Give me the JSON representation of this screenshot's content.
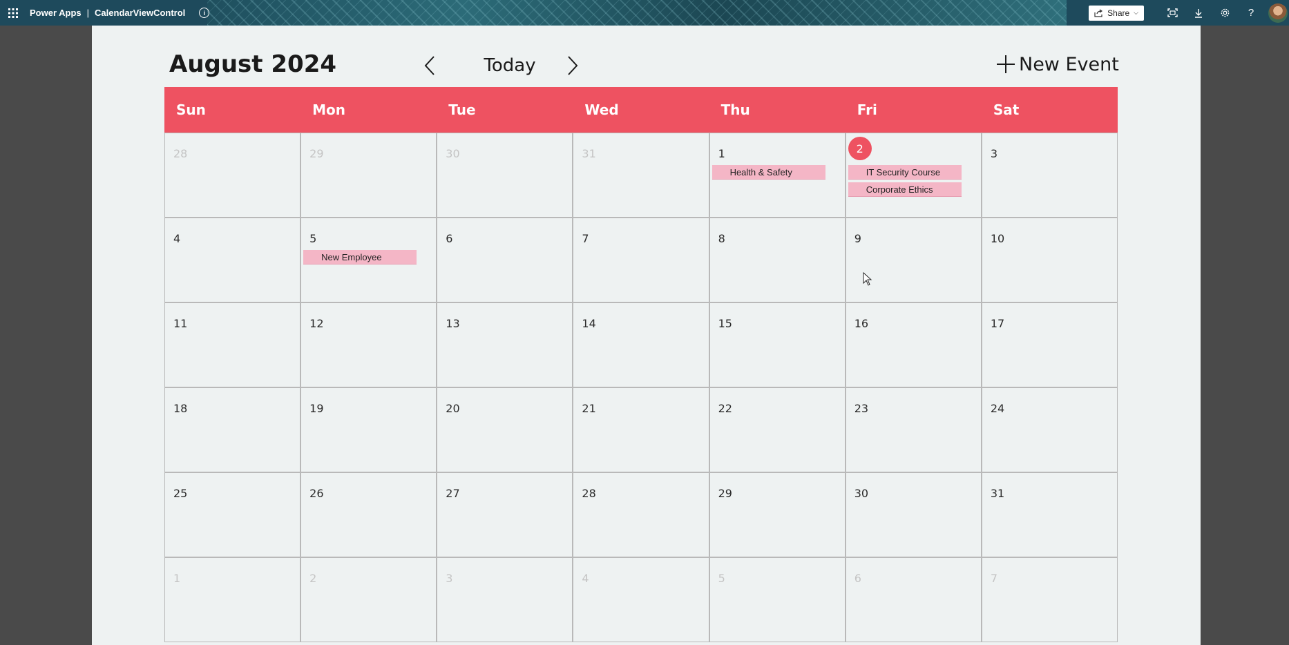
{
  "topbar": {
    "app_name": "Power Apps",
    "separator": "|",
    "app_title": "CalendarViewControl",
    "share_label": "Share",
    "icons": [
      "waffle-icon",
      "info-icon",
      "share-icon",
      "fit-screen-icon",
      "download-icon",
      "settings-icon",
      "help-icon",
      "avatar"
    ]
  },
  "calendar": {
    "title": "August 2024",
    "today_label": "Today",
    "new_event_label": "New Event",
    "day_headers": [
      "Sun",
      "Mon",
      "Tue",
      "Wed",
      "Thu",
      "Fri",
      "Sat"
    ],
    "weeks": [
      [
        {
          "day": "28",
          "other": true
        },
        {
          "day": "29",
          "other": true
        },
        {
          "day": "30",
          "other": true
        },
        {
          "day": "31",
          "other": true
        },
        {
          "day": "1",
          "events": [
            "Health & Safety"
          ]
        },
        {
          "day": "2",
          "today": true,
          "events": [
            "IT Security Course",
            "Corporate Ethics"
          ]
        },
        {
          "day": "3"
        }
      ],
      [
        {
          "day": "4"
        },
        {
          "day": "5",
          "events": [
            "New Employee"
          ]
        },
        {
          "day": "6"
        },
        {
          "day": "7"
        },
        {
          "day": "8"
        },
        {
          "day": "9"
        },
        {
          "day": "10"
        }
      ],
      [
        {
          "day": "11"
        },
        {
          "day": "12"
        },
        {
          "day": "13"
        },
        {
          "day": "14"
        },
        {
          "day": "15"
        },
        {
          "day": "16"
        },
        {
          "day": "17"
        }
      ],
      [
        {
          "day": "18"
        },
        {
          "day": "19"
        },
        {
          "day": "20"
        },
        {
          "day": "21"
        },
        {
          "day": "22"
        },
        {
          "day": "23"
        },
        {
          "day": "24"
        }
      ],
      [
        {
          "day": "25"
        },
        {
          "day": "26"
        },
        {
          "day": "27"
        },
        {
          "day": "28"
        },
        {
          "day": "29"
        },
        {
          "day": "30"
        },
        {
          "day": "31"
        }
      ],
      [
        {
          "day": "1",
          "other": true
        },
        {
          "day": "2",
          "other": true
        },
        {
          "day": "3",
          "other": true
        },
        {
          "day": "4",
          "other": true
        },
        {
          "day": "5",
          "other": true
        },
        {
          "day": "6",
          "other": true
        },
        {
          "day": "7",
          "other": true
        }
      ]
    ]
  },
  "colors": {
    "header_bg": "#ee5261",
    "event_bg": "#f4b6c6",
    "today_circle": "#ee5261",
    "topbar_bg": "#1e4a5c"
  }
}
